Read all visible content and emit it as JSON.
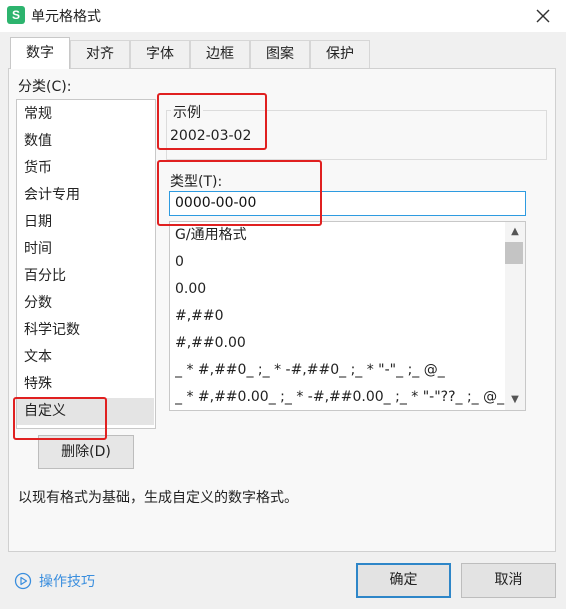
{
  "window": {
    "app_badge": "S",
    "title": "单元格格式"
  },
  "tabs": [
    {
      "label": "数字",
      "active": true
    },
    {
      "label": "对齐",
      "active": false
    },
    {
      "label": "字体",
      "active": false
    },
    {
      "label": "边框",
      "active": false
    },
    {
      "label": "图案",
      "active": false
    },
    {
      "label": "保护",
      "active": false
    }
  ],
  "category": {
    "label": "分类(C):",
    "items": [
      "常规",
      "数值",
      "货币",
      "会计专用",
      "日期",
      "时间",
      "百分比",
      "分数",
      "科学记数",
      "文本",
      "特殊",
      "自定义"
    ],
    "selected": "自定义"
  },
  "sample": {
    "legend": "示例",
    "value": "2002-03-02"
  },
  "type": {
    "label": "类型(T):",
    "value": "0000-00-00",
    "formats": [
      "G/通用格式",
      "0",
      "0.00",
      "#,##0",
      "#,##0.00",
      "_ * #,##0_ ;_ * -#,##0_ ;_ * \"-\"_ ;_ @_",
      "_ * #,##0.00_ ;_ * -#,##0.00_ ;_ * \"-\"??_ ;_ @_"
    ]
  },
  "buttons": {
    "delete": "删除(D)",
    "ok": "确定",
    "cancel": "取消"
  },
  "description": "以现有格式为基础，生成自定义的数字格式。",
  "tips": {
    "label": "操作技巧"
  },
  "colors": {
    "accent": "#2e86c8",
    "highlight": "#e02020",
    "link": "#3a8ede",
    "app_badge": "#2db46e"
  }
}
